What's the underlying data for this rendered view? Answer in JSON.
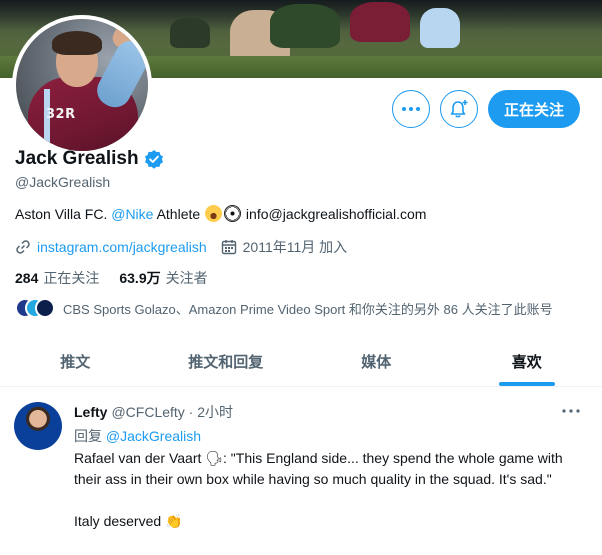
{
  "profile": {
    "name": "Jack Grealish",
    "handle": "@JackGrealish",
    "bio_prefix": "Aston Villa FC. ",
    "bio_mention": "@Nike",
    "bio_suffix": " Athlete ",
    "bio_email": " info@jackgrealishofficial.com",
    "avatar_number": "32R",
    "link": "instagram.com/jackgrealish",
    "joined": "2011年11月 加入",
    "following_count": "284",
    "following_label": "正在关注",
    "followers_count": "63.9万",
    "followers_label": "关注者",
    "followers_you_know": "CBS Sports Golazo、Amazon Prime Video Sport 和你关注的另外 86 人关注了此账号"
  },
  "actions": {
    "follow_label": "正在关注",
    "more_icon": "more-dots-icon",
    "notify_icon": "bell-plus-icon"
  },
  "tabs": [
    {
      "label": "推文"
    },
    {
      "label": "推文和回复"
    },
    {
      "label": "媒体"
    },
    {
      "label": "喜欢",
      "active": true
    }
  ],
  "tweet": {
    "author_name": "Lefty",
    "author_handle": "@CFCLefty · 2小时",
    "reply_prefix": "回复 ",
    "reply_to": "@JackGrealish",
    "line1": "Rafael van der Vaart 🗣: \"This England side... they spend the whole game with their ass in their own box while having so much quality in the squad. It's sad.\"",
    "line2": "Italy deserved 👏"
  },
  "colors": {
    "accent": "#1d9bf0",
    "text": "#0f1419",
    "muted": "#536471"
  }
}
